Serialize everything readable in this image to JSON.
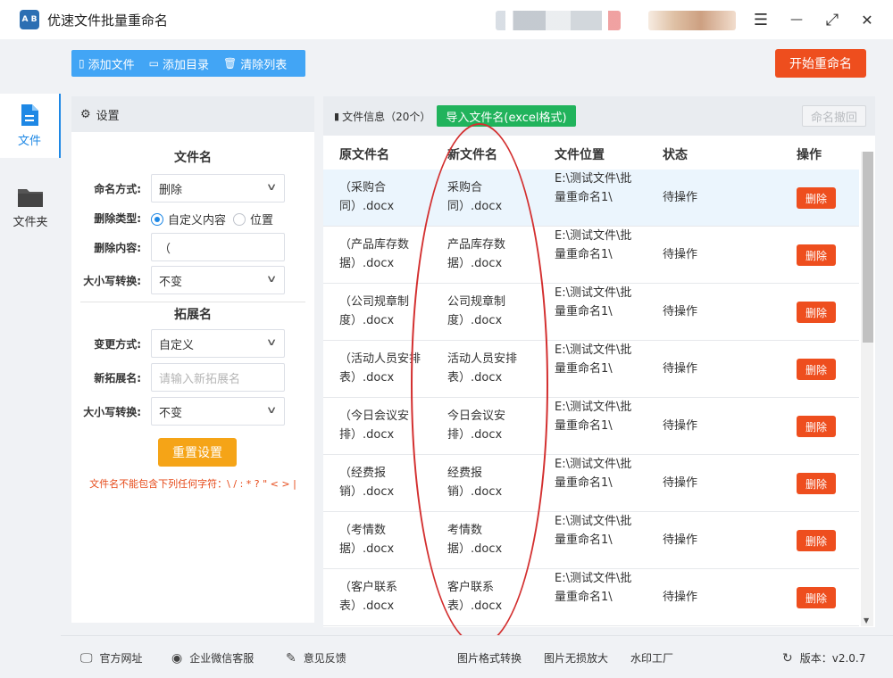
{
  "app": {
    "logo_text": "A B",
    "title": "优速文件批量重命名"
  },
  "window_controls": {
    "menu": "☰",
    "minimize": "—",
    "maximize": "⤢",
    "close": "✕"
  },
  "toolbar": {
    "add_file": "添加文件",
    "add_dir": "添加目录",
    "clear_list": "清除列表",
    "start_rename": "开始重命名"
  },
  "nav": {
    "file": "文件",
    "folder": "文件夹"
  },
  "settings": {
    "header": "设置",
    "filename_section": "文件名",
    "naming_mode_label": "命名方式:",
    "naming_mode_value": "删除",
    "delete_type_label": "删除类型:",
    "delete_type_option1": "自定义内容",
    "delete_type_option2": "位置",
    "delete_content_label": "删除内容:",
    "delete_content_value": "（",
    "case_label": "大小写转换:",
    "case_value": "不变",
    "ext_section": "拓展名",
    "change_mode_label": "变更方式:",
    "change_mode_value": "自定义",
    "new_ext_label": "新拓展名:",
    "new_ext_placeholder": "请输入新拓展名",
    "ext_case_label": "大小写转换:",
    "ext_case_value": "不变",
    "reset_button": "重置设置",
    "warning": "文件名不能包含下列任何字符：\\ / : * ? \" < > |"
  },
  "file_panel": {
    "title": "文件信息（20个）",
    "import_button": "导入文件名(excel格式)",
    "undo_button": "命名撤回",
    "columns": [
      "原文件名",
      "新文件名",
      "文件位置",
      "状态",
      "操作"
    ],
    "rows": [
      {
        "orig": "（采购合同）.docx",
        "new": "采购合同）.docx",
        "loc": "E:\\测试文件\\批量重命名1\\",
        "status": "待操作",
        "action": "删除"
      },
      {
        "orig": "（产品库存数据）.docx",
        "new": "产品库存数据）.docx",
        "loc": "E:\\测试文件\\批量重命名1\\",
        "status": "待操作",
        "action": "删除"
      },
      {
        "orig": "（公司规章制度）.docx",
        "new": "公司规章制度）.docx",
        "loc": "E:\\测试文件\\批量重命名1\\",
        "status": "待操作",
        "action": "删除"
      },
      {
        "orig": "（活动人员安排表）.docx",
        "new": "活动人员安排表）.docx",
        "loc": "E:\\测试文件\\批量重命名1\\",
        "status": "待操作",
        "action": "删除"
      },
      {
        "orig": "（今日会议安排）.docx",
        "new": "今日会议安排）.docx",
        "loc": "E:\\测试文件\\批量重命名1\\",
        "status": "待操作",
        "action": "删除"
      },
      {
        "orig": "（经费报销）.docx",
        "new": "经费报销）.docx",
        "loc": "E:\\测试文件\\批量重命名1\\",
        "status": "待操作",
        "action": "删除"
      },
      {
        "orig": "（考情数据）.docx",
        "new": "考情数据）.docx",
        "loc": "E:\\测试文件\\批量重命名1\\",
        "status": "待操作",
        "action": "删除"
      },
      {
        "orig": "（客户联系表）.docx",
        "new": "客户联系表）.docx",
        "loc": "E:\\测试文件\\批量重命名1\\",
        "status": "待操作",
        "action": "删除"
      }
    ]
  },
  "footer": {
    "website": "官方网址",
    "wechat": "企业微信客服",
    "feedback": "意见反馈",
    "img_convert": "图片格式转换",
    "img_enlarge": "图片无损放大",
    "watermark": "水印工厂",
    "version": "版本：v2.0.7"
  },
  "colors": {
    "accent_blue": "#42a5f5",
    "start_red": "#ee4e1e",
    "import_green": "#21b35c",
    "reset_orange": "#f5a417"
  }
}
